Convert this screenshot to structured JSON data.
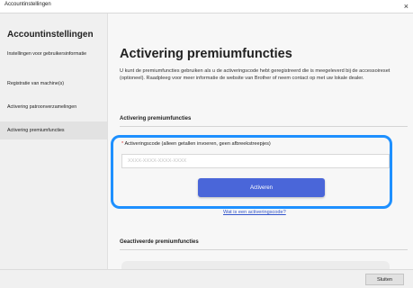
{
  "window": {
    "title": "Accountinstellingen",
    "close_glyph": "×"
  },
  "sidebar": {
    "heading": "Accountinstellingen",
    "items": [
      {
        "label": "Instellingen voor gebruikersinformatie",
        "active": false
      },
      {
        "label": "Registratie van machine(s)",
        "active": false
      },
      {
        "label": "Activering patroonverzamelingen",
        "active": false
      },
      {
        "label": "Activering premiumfuncties",
        "active": true
      }
    ]
  },
  "main": {
    "title": "Activering premiumfuncties",
    "intro": "U kunt de premiumfuncties gebruiken als u de activeringscode hebt geregistreerd die is meegeleverd bij de accessoireset (optioneel). Raadpleeg voor meer informatie de website van Brother of neem contact op met uw lokale dealer.",
    "activation_section": {
      "title": "Activering premiumfuncties",
      "required_marker": "*",
      "field_label": "Activeringscode (alleen getallen invoeren, geen afbreekstreepjes)",
      "field_value": "",
      "field_placeholder": "XXXX-XXXX-XXXX-XXXX",
      "activate_label": "Activeren",
      "link_label": "Wat is een activeringscode?"
    },
    "activated_section": {
      "title": "Geactiveerde premiumfuncties"
    }
  },
  "footer": {
    "close_label": "Sluiten"
  },
  "colors": {
    "accent_button": "#4a66d9",
    "highlight_border": "#1e90ff",
    "link": "#3355cc"
  }
}
